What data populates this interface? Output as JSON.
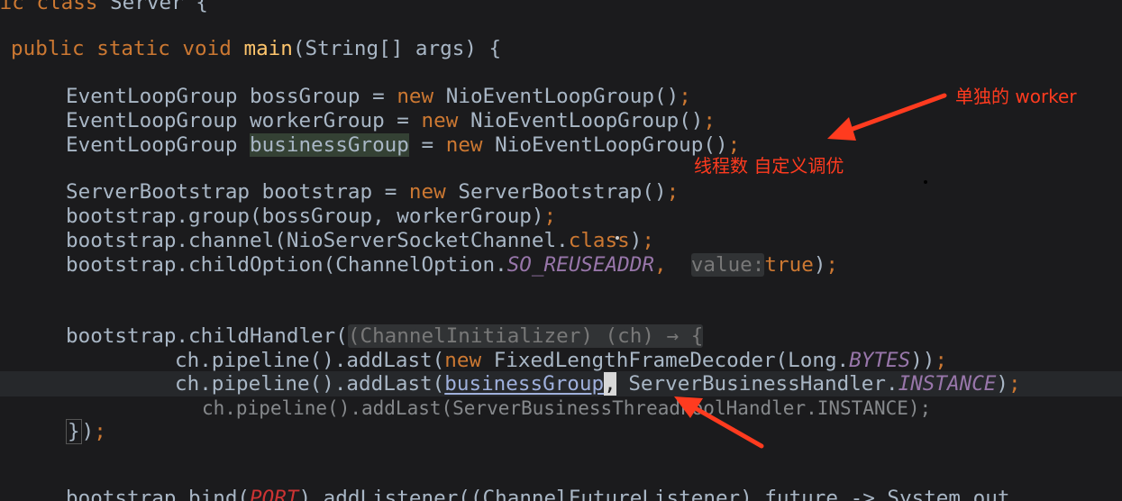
{
  "code": {
    "class_decl": {
      "prefix": "lic class",
      "name": "Server",
      "brace": "{"
    },
    "main_decl": {
      "mod": "public static void",
      "name": "main",
      "params": "(String[] args) {"
    },
    "boss": {
      "type": "EventLoopGroup",
      "var": "bossGroup",
      "eq": "=",
      "kw": "new",
      "ctor": "NioEventLoopGroup",
      "tail": "()",
      "semi": ";"
    },
    "worker": {
      "type": "EventLoopGroup",
      "var": "workerGroup",
      "eq": "=",
      "kw": "new",
      "ctor": "NioEventLoopGroup",
      "tail": "()",
      "semi": ";"
    },
    "business": {
      "type": "EventLoopGroup",
      "var": "businessGroup",
      "eq": "=",
      "kw": "new",
      "ctor": "NioEventLoopGroup",
      "tail": "()",
      "semi": ";"
    },
    "bootstrap_decl": {
      "type": "ServerBootstrap",
      "var": "bootstrap",
      "eq": "=",
      "kw": "new",
      "ctor": "ServerBootstrap",
      "tail": "()",
      "semi": ";"
    },
    "group_call": {
      "text": "bootstrap.group(bossGroup, workerGroup)",
      "semi": ";"
    },
    "channel_call": {
      "text": "bootstrap.channel(NioServerSocketChannel.",
      "kw": "class",
      "tail": ")",
      "semi": ";"
    },
    "child_option": {
      "text": "bootstrap.childOption(ChannelOption.",
      "field": "SO_REUSEADDR",
      "comma": ",",
      "hint": "value:",
      "kw": "true",
      "tail": ")",
      "semi": ";"
    },
    "child_handler": {
      "text": "bootstrap.childHandler(",
      "hint": "(ChannelInitializer) (ch) → {"
    },
    "pipeline1": {
      "text": "ch.pipeline().addLast(",
      "kw": "new",
      "ctor": "FixedLengthFrameDecoder(Long.",
      "field": "BYTES",
      "tail": "))",
      "semi": ";"
    },
    "pipeline2": {
      "text": "ch.pipeline().addLast(",
      "var": "businessGroup",
      "comma": ",",
      "handler": "ServerBusinessHandler.",
      "field": "INSTANCE",
      "tail": ")",
      "semi": ";"
    },
    "pipeline3": {
      "text": "ch.pipeline().addLast(ServerBusinessThreadPoolHandler.INSTANCE);"
    },
    "close_handler": {
      "brace": "}",
      "tail": ")",
      "semi": ";"
    },
    "bind_call": {
      "text": "bootstrap.bind(",
      "field": "PORT",
      "tail": ").addListener((ChannelFutureListener) future -> System.out"
    }
  },
  "annotations": {
    "top": "单独的 worker",
    "middle": "线程数 自定义调优"
  },
  "colors": {
    "background": "#1b1b1d",
    "keyword": "#cc7832",
    "method": "#ffc66d",
    "identifier": "#a9b7c6",
    "static_field": "#9876aa",
    "annotation": "#ff3b1f"
  }
}
